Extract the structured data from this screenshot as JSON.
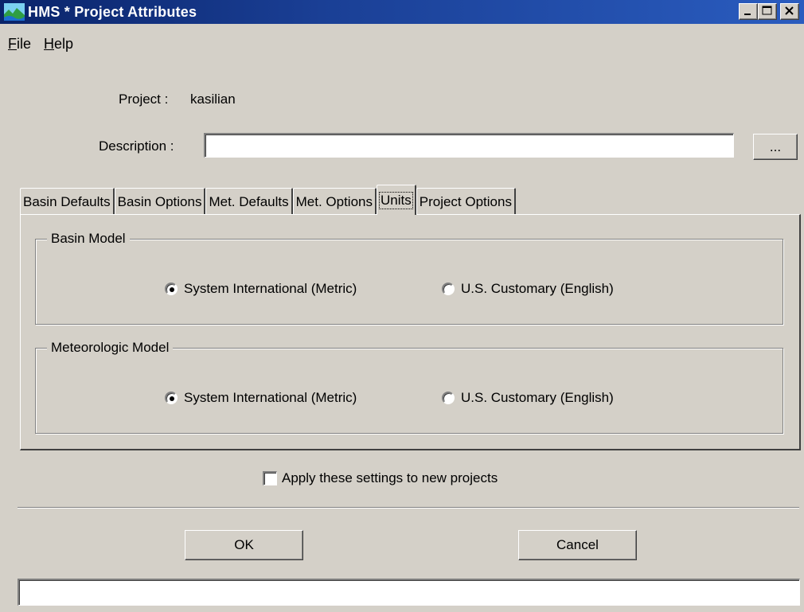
{
  "window": {
    "title": "HMS * Project Attributes",
    "controls": {
      "minimize": "_",
      "maximize": "□",
      "close": "×"
    }
  },
  "menu": {
    "items": [
      {
        "label_underline": "F",
        "label_rest": "ile"
      },
      {
        "label_underline": "H",
        "label_rest": "elp"
      }
    ]
  },
  "form": {
    "project_label": "Project :",
    "project_value": "kasilian",
    "description_label": "Description :",
    "description_value": "",
    "browse_button": "..."
  },
  "tabs": [
    {
      "label": "Basin Defaults",
      "active": false
    },
    {
      "label": "Basin Options",
      "active": false
    },
    {
      "label": "Met. Defaults",
      "active": false
    },
    {
      "label": "Met. Options",
      "active": false
    },
    {
      "label": "Units",
      "active": true
    },
    {
      "label": "Project Options",
      "active": false
    }
  ],
  "units_panel": {
    "basin_model": {
      "title": "Basin Model",
      "option_metric": "System International (Metric)",
      "option_english": "U.S. Customary (English)",
      "selected": "metric"
    },
    "meteorologic_model": {
      "title": "Meteorologic Model",
      "option_metric": "System International (Metric)",
      "option_english": "U.S. Customary (English)",
      "selected": "metric"
    }
  },
  "apply_checkbox": {
    "label": "Apply these settings to new projects",
    "checked": false
  },
  "buttons": {
    "ok": "OK",
    "cancel": "Cancel"
  },
  "status_bar": {
    "text": ""
  },
  "colors": {
    "title_bar": "#0a246a",
    "face": "#d4d0c8"
  }
}
